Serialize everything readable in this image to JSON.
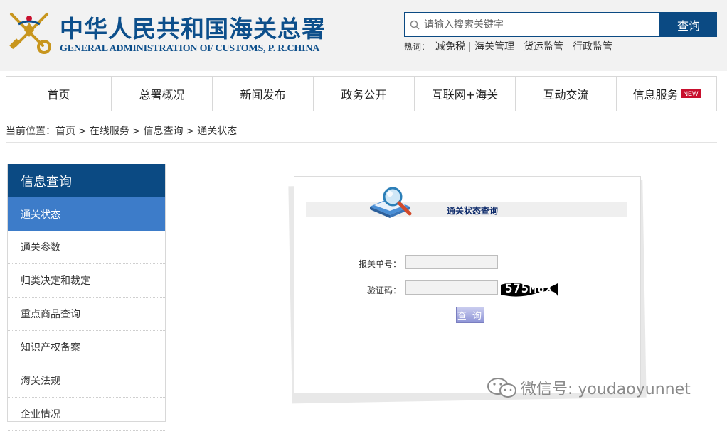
{
  "header": {
    "title_cn": "中华人民共和国海关总署",
    "title_en": "GENERAL ADMINISTRATION OF CUSTOMS, P. R.CHINA",
    "search": {
      "placeholder": "请输入搜索关键字",
      "button_label": "查询"
    },
    "hot": {
      "label": "热词：",
      "links": [
        "减免税",
        "海关管理",
        "货运监管",
        "行政监管"
      ]
    }
  },
  "nav": {
    "items": [
      {
        "label": "首页"
      },
      {
        "label": "总署概况"
      },
      {
        "label": "新闻发布"
      },
      {
        "label": "政务公开"
      },
      {
        "label": "互联网+海关"
      },
      {
        "label": "互动交流"
      },
      {
        "label": "信息服务",
        "badge": "NEW"
      }
    ]
  },
  "breadcrumb": {
    "prefix": "当前位置：",
    "items": [
      "首页",
      "在线服务",
      "信息查询",
      "通关状态"
    ],
    "separator": ">"
  },
  "sidebar": {
    "title": "信息查询",
    "items": [
      "通关状态",
      "通关参数",
      "归类决定和裁定",
      "重点商品查询",
      "知识产权备案",
      "海关法规",
      "企业情况"
    ]
  },
  "panel": {
    "title": "通关状态查询",
    "declaration_label": "报关单号：",
    "declaration_value": "",
    "captcha_label": "验证码：",
    "captcha_value": "",
    "captcha_text": "575M6X",
    "query_button_label": "查 询"
  },
  "watermark": {
    "text": "微信号: youdaoyunnet"
  },
  "colors": {
    "brand_blue": "#0b4a83",
    "active_blue": "#3d7cc9",
    "new_badge_red": "#c8102e"
  }
}
